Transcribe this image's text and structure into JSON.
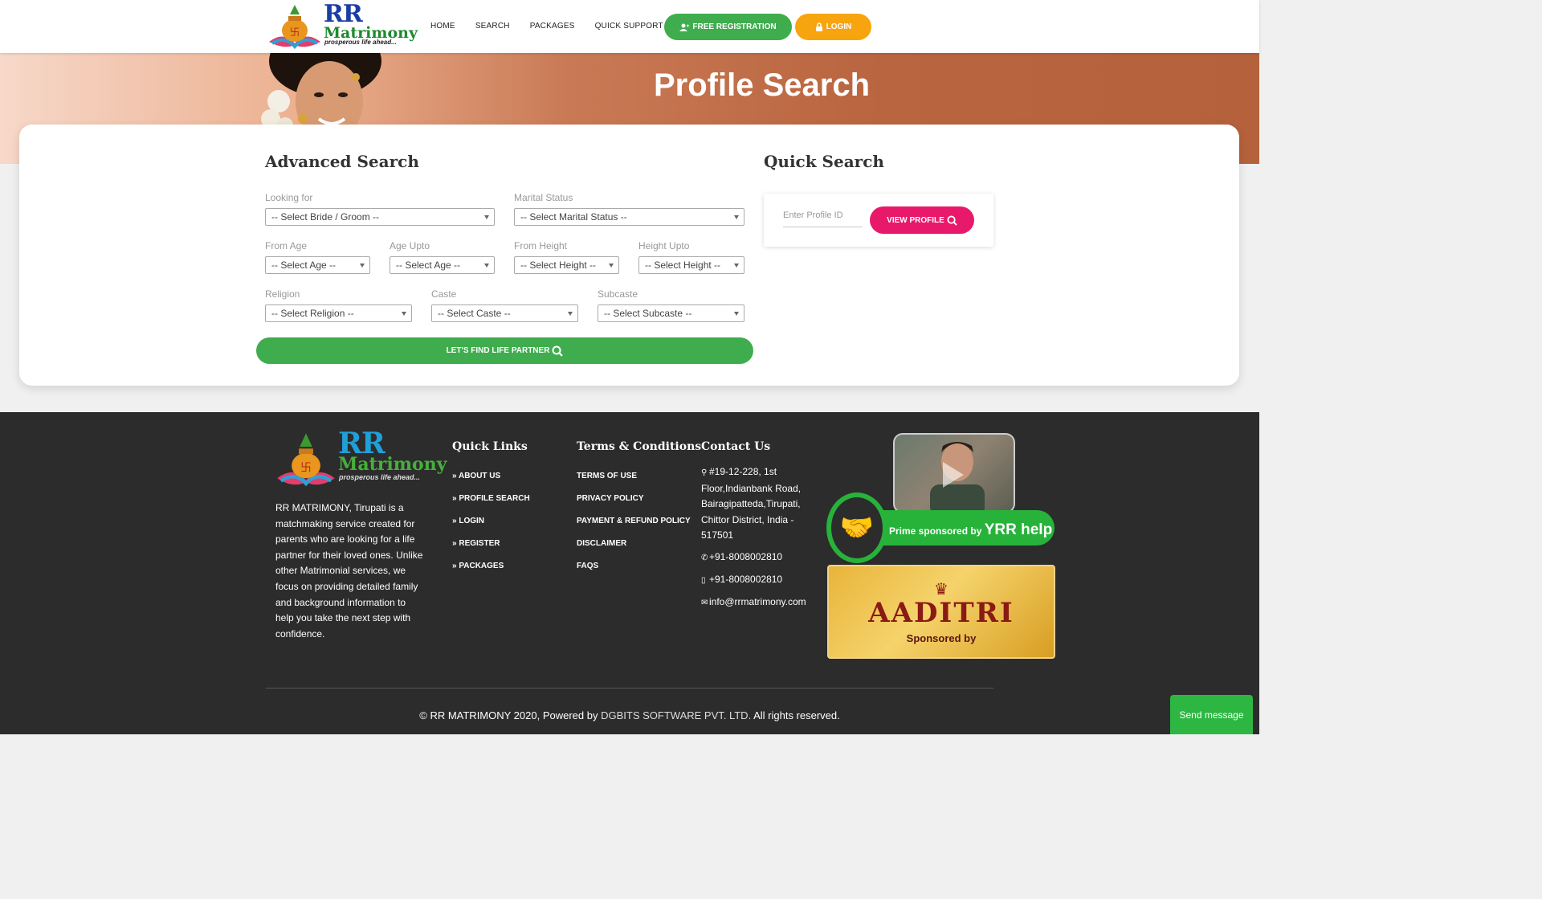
{
  "brand": {
    "name_line1": "RR",
    "name_line2": "Matrimony",
    "tagline": "prosperous life ahead..."
  },
  "nav": {
    "items": [
      "HOME",
      "SEARCH",
      "PACKAGES",
      "QUICK SUPPORT"
    ],
    "register_label": "FREE REGISTRATION",
    "login_label": "LOGIN"
  },
  "hero": {
    "title": "Profile Search"
  },
  "advanced_search": {
    "title": "Advanced Search",
    "fields": {
      "looking_for": {
        "label": "Looking for",
        "value": "-- Select Bride / Groom --"
      },
      "marital_status": {
        "label": "Marital Status",
        "value": "-- Select Marital Status --"
      },
      "from_age": {
        "label": "From Age",
        "value": "-- Select Age --"
      },
      "age_upto": {
        "label": "Age Upto",
        "value": "-- Select Age --"
      },
      "from_height": {
        "label": "From Height",
        "value": "-- Select Height --"
      },
      "height_upto": {
        "label": "Height Upto",
        "value": "-- Select Height --"
      },
      "religion": {
        "label": "Religion",
        "value": "-- Select Religion --"
      },
      "caste": {
        "label": "Caste",
        "value": "-- Select Caste --"
      },
      "subcaste": {
        "label": "Subcaste",
        "value": "-- Select Subcaste --"
      }
    },
    "submit_label": "LET'S FIND LIFE PARTNER"
  },
  "quick_search": {
    "title": "Quick Search",
    "placeholder": "Enter Profile ID",
    "button_label": "VIEW PROFILE"
  },
  "footer": {
    "about": "RR MATRIMONY, Tirupati is a matchmaking service created for parents who are looking for a life partner for their loved ones. Unlike other Matrimonial services, we focus on providing detailed family and background information to help you take the next step with confidence.",
    "quick_links_title": "Quick Links",
    "quick_links": [
      "ABOUT US",
      "PROFILE SEARCH",
      "LOGIN",
      "REGISTER",
      "PACKAGES"
    ],
    "terms_title": "Terms & Conditions",
    "terms_links": [
      "TERMS OF USE",
      "PRIVACY POLICY",
      "PAYMENT & REFUND POLICY",
      "DISCLAIMER",
      "FAQS"
    ],
    "contact_title": "Contact Us",
    "address": "#19-12-228, 1st Floor,Indianbank Road, Bairagipatteda,Tirupati, Chittor District, India - 517501",
    "phone": "+91-8008002810",
    "mobile": "+91-8008002810",
    "email": "info@rrmatrimony.com",
    "sponsor_prime_text": "Prime sponsored by",
    "sponsor_prime_name": "YRR help",
    "sponsor_aaditri_name": "AADITRI",
    "sponsor_aaditri_text": "Sponsored by",
    "copyright_prefix": "© RR MATRIMONY 2020, Powered by",
    "copyright_company": "DGBITS SOFTWARE PVT. LTD.",
    "copyright_suffix": "All rights reserved."
  },
  "chat": {
    "send_label": "Send message"
  },
  "colors": {
    "green": "#3fad4e",
    "orange": "#f7a40f",
    "pink": "#e8196b",
    "footer_bg": "#2c2c2c"
  }
}
